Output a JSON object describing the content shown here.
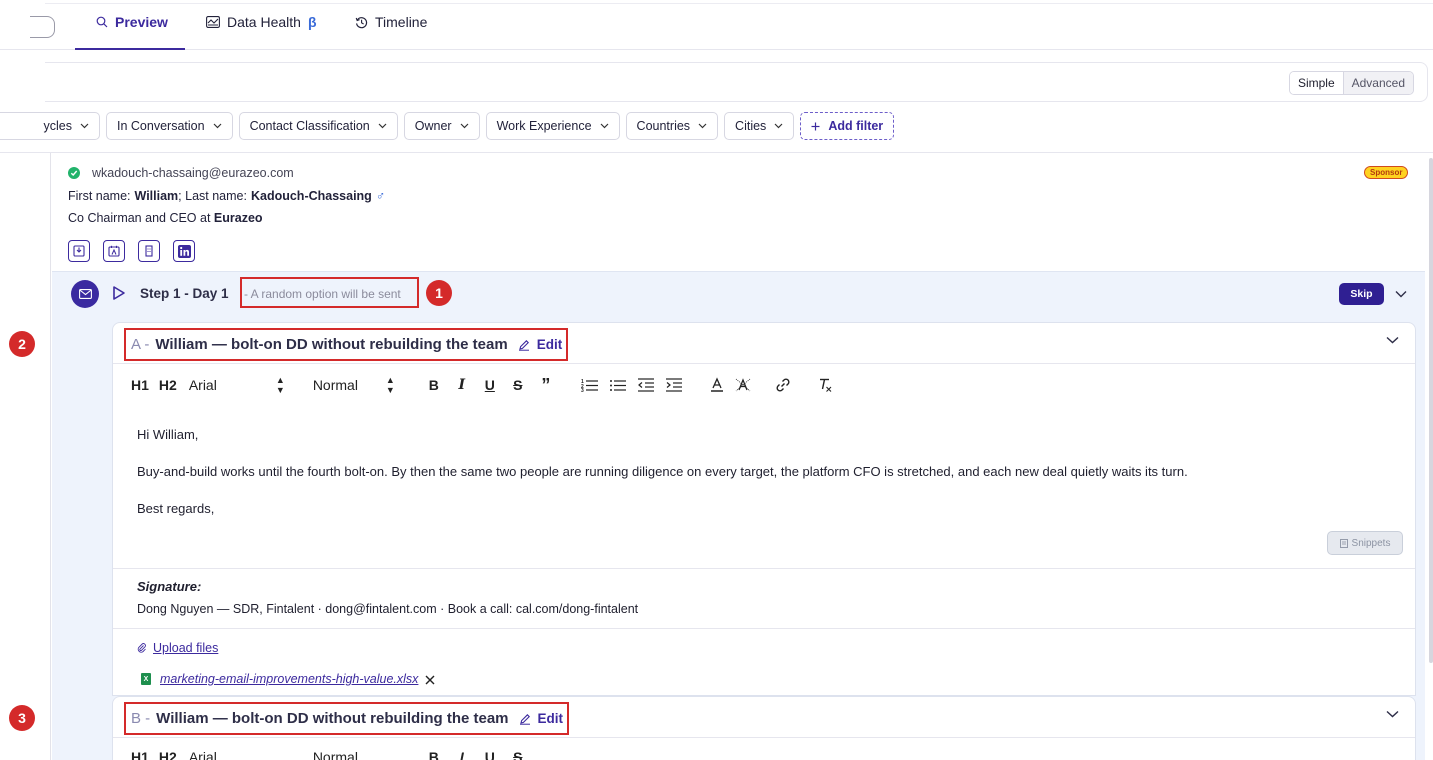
{
  "tabs": [
    {
      "label": "Preview",
      "active": true,
      "icon": "search-icon"
    },
    {
      "label": "Data Health",
      "suffix": "β",
      "active": false,
      "icon": "data-health-icon"
    },
    {
      "label": "Timeline",
      "active": false,
      "icon": "history-icon"
    }
  ],
  "view_toggle": {
    "simple": "Simple",
    "advanced": "Advanced",
    "selected": "Simple"
  },
  "filters": [
    "ycles",
    "In Conversation",
    "Contact Classification",
    "Owner",
    "Work Experience",
    "Countries",
    "Cities"
  ],
  "add_filter": "Add filter",
  "contact": {
    "email": "wkadouch-chassaing@eurazeo.com",
    "first_name_label": "First name:",
    "first_name": "William",
    "last_name_label": "; Last name:",
    "last_name": "Kadouch-Chassaing",
    "gender_symbol": "♂",
    "title_prefix": "Co Chairman and CEO at",
    "company": "Eurazeo",
    "tag": "Sponsor"
  },
  "step": {
    "title": "Step 1 - Day 1",
    "note": "- A random option will be sent",
    "skip_label": "Skip"
  },
  "annotations": [
    "1",
    "2",
    "3"
  ],
  "toolbar": {
    "h1": "H1",
    "h2": "H2",
    "font": "Arial",
    "size": "Normal"
  },
  "variants": [
    {
      "letter": "A -",
      "subject": "William — bolt-on DD without rebuilding the team",
      "edit_label": "Edit",
      "greeting": "Hi William,",
      "body": "Buy-and-build works until the fourth bolt-on. By then the same two people are running diligence on every target, the platform CFO is stretched, and each new deal quietly waits its turn.",
      "closing": "Best regards,",
      "snippets_label": "Snippets",
      "signature_label": "Signature:",
      "signature": "Dong Nguyen — SDR, Fintalent · dong@fintalent.com · Book a call: cal.com/dong-fintalent",
      "upload_label": "Upload files",
      "attachment": "marketing-email-improvements-high-value.xlsx"
    },
    {
      "letter": "B -",
      "subject": "William — bolt-on DD without rebuilding the team",
      "edit_label": "Edit"
    }
  ],
  "colors": {
    "accent": "#3c2a9e",
    "annotation_red": "#d42a2a",
    "step_bg": "#eef3fc"
  }
}
